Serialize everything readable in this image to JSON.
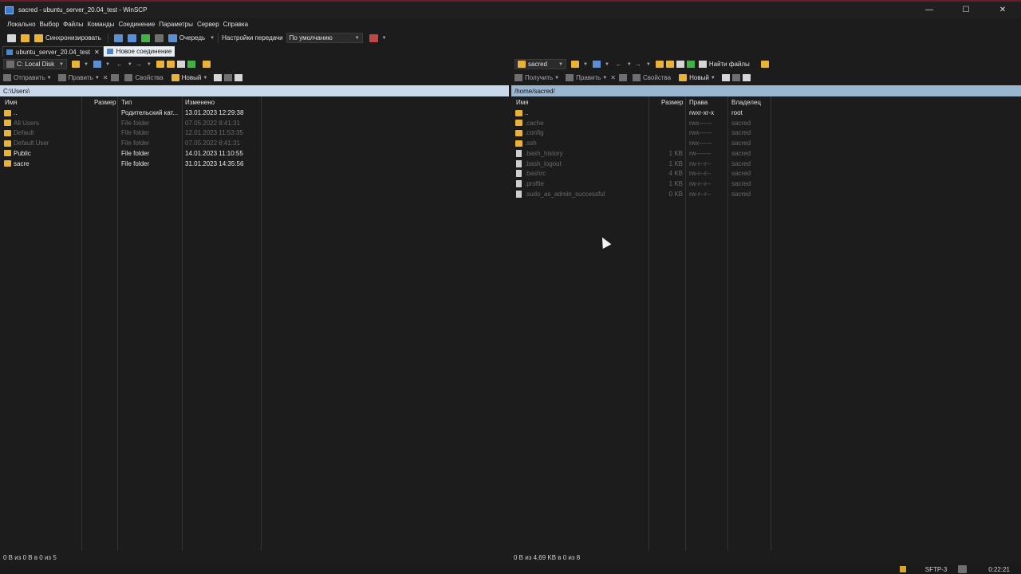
{
  "window": {
    "title": "sacred - ubuntu_server_20.04_test - WinSCP",
    "controls": [
      "—",
      "☐",
      "✕"
    ]
  },
  "menu": [
    "Локально",
    "Выбор",
    "Файлы",
    "Команды",
    "Соединение",
    "Параметры",
    "Сервер",
    "Справка"
  ],
  "toolbar": {
    "sync_label": "Синхронизировать",
    "queue_label": "Очередь",
    "transfer_settings_label": "Настройки передачи",
    "transfer_preset": "По умолчанию"
  },
  "tabs": {
    "session": "ubuntu_server_20.04_test",
    "close": "✕",
    "new_session": "Новое соединение"
  },
  "local": {
    "drive": "C: Local Disk",
    "actions": {
      "upload": "Отправить",
      "edit": "Править",
      "properties": "Свойства",
      "new": "Новый"
    },
    "path": "C:\\Users\\",
    "columns": {
      "name": "Имя",
      "size": "Размер",
      "type": "Тип",
      "modified": "Изменено"
    },
    "rows": [
      {
        "name": "..",
        "size": "",
        "type": "Родительский кат...",
        "modified": "13.01.2023  12:29:38",
        "hidden": false
      },
      {
        "name": "All Users",
        "size": "",
        "type": "File folder",
        "modified": "07.05.2022  8:41:31",
        "hidden": true
      },
      {
        "name": "Default",
        "size": "",
        "type": "File folder",
        "modified": "12.01.2023  11:53:35",
        "hidden": true
      },
      {
        "name": "Default User",
        "size": "",
        "type": "File folder",
        "modified": "07.05.2022  8:41:31",
        "hidden": true
      },
      {
        "name": "Public",
        "size": "",
        "type": "File folder",
        "modified": "14.01.2023  11:10:55",
        "hidden": false
      },
      {
        "name": "sacre",
        "size": "",
        "type": "File folder",
        "modified": "31.01.2023  14:35:56",
        "hidden": false
      }
    ],
    "status": "0 B из 0 B в 0 из 5"
  },
  "remote": {
    "folder": "sacred",
    "find_files": "Найти файлы",
    "actions": {
      "download": "Получить",
      "edit": "Править",
      "properties": "Свойства",
      "new": "Новый"
    },
    "path": "/home/sacred/",
    "columns": {
      "name": "Имя",
      "size": "Размер",
      "rights": "Права",
      "owner": "Владелец"
    },
    "rows": [
      {
        "name": "..",
        "kind": "up",
        "size": "",
        "rights": "rwxr-xr-x",
        "owner": "root",
        "hidden": false
      },
      {
        "name": ".cache",
        "kind": "folder",
        "size": "",
        "rights": "rwx------",
        "owner": "sacred",
        "hidden": true
      },
      {
        "name": ".config",
        "kind": "folder",
        "size": "",
        "rights": "rwx------",
        "owner": "sacred",
        "hidden": true
      },
      {
        "name": ".ssh",
        "kind": "folder",
        "size": "",
        "rights": "rwx------",
        "owner": "sacred",
        "hidden": true
      },
      {
        "name": ".bash_history",
        "kind": "file",
        "size": "1 KB",
        "rights": "rw-------",
        "owner": "sacred",
        "hidden": true
      },
      {
        "name": ".bash_logout",
        "kind": "file",
        "size": "1 KB",
        "rights": "rw-r--r--",
        "owner": "sacred",
        "hidden": true
      },
      {
        "name": ".bashrc",
        "kind": "file",
        "size": "4 KB",
        "rights": "rw-r--r--",
        "owner": "sacred",
        "hidden": true
      },
      {
        "name": ".profile",
        "kind": "file",
        "size": "1 KB",
        "rights": "rw-r--r--",
        "owner": "sacred",
        "hidden": true
      },
      {
        "name": ".sudo_as_admin_successful",
        "kind": "file",
        "size": "0 KB",
        "rights": "rw-r--r--",
        "owner": "sacred",
        "hidden": true
      }
    ],
    "status": "0 B из 4,69 KB в 0 из 8"
  },
  "statusbar": {
    "protocol": "SFTP-3",
    "time": "0:22:21"
  },
  "colors": {
    "accent_path": "#c9d8ea",
    "folder": "#e8b33a",
    "title_border": "#6b1e2a"
  }
}
